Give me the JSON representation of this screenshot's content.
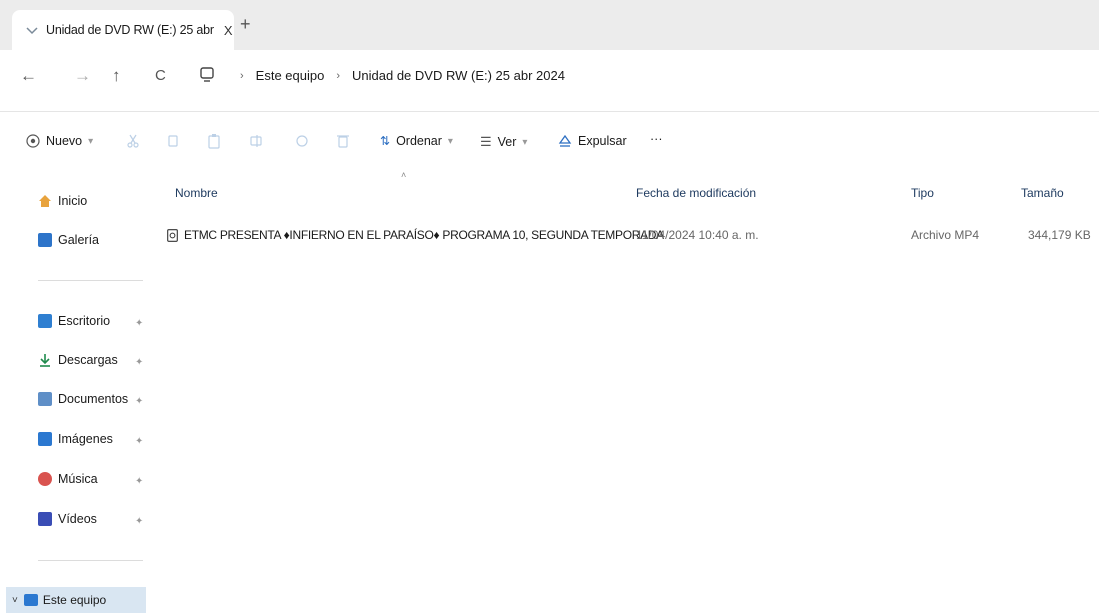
{
  "tab": {
    "title": "Unidad de DVD RW (E:) 25 abr",
    "close_label": "X",
    "new_tab_label": "+"
  },
  "nav": {
    "back_icon": "←",
    "forward_icon": "→",
    "up_icon": "↑",
    "refresh_icon": "C",
    "breadcrumbs": [
      "Este equipo",
      "Unidad de DVD RW (E:) 25 abr 2024"
    ]
  },
  "toolbar": {
    "new_label": "Nuevo",
    "sort_label": "Ordenar",
    "view_label": "Ver",
    "eject_label": "Expulsar",
    "more_label": "···"
  },
  "sidebar": {
    "items": [
      {
        "label": "Inicio",
        "icon": "home-icon",
        "color": "#e8a33d"
      },
      {
        "label": "Galería",
        "icon": "gallery-icon",
        "color": "#2d74c9"
      },
      {
        "label": "Escritorio",
        "icon": "desktop-icon",
        "color": "#2f7fd1"
      },
      {
        "label": "Descargas",
        "icon": "download-icon",
        "color": "#1f8a4c"
      },
      {
        "label": "Documentos",
        "icon": "documents-icon",
        "color": "#5f8fc7"
      },
      {
        "label": "Imágenes",
        "icon": "pictures-icon",
        "color": "#2b78d0"
      },
      {
        "label": "Música",
        "icon": "music-icon",
        "color": "#d9534f"
      },
      {
        "label": "Vídeos",
        "icon": "videos-icon",
        "color": "#3a4db5"
      }
    ],
    "this_pc_label": "Este equipo"
  },
  "columns": {
    "name": "Nombre",
    "date": "Fecha de modificación",
    "type": "Tipo",
    "size": "Tamaño"
  },
  "files": [
    {
      "name": "ETMC PRESENTA ♦INFIERNO EN EL PARAÍSO♦ PROGRAMA 10, SEGUNDA TEMPORADA",
      "date": "11/04/2024 10:40 a. m.",
      "type": "Archivo MP4",
      "size": "344,179 KB"
    }
  ],
  "colors": {
    "accent": "#0067c0",
    "selection": "#d9e6f2",
    "column_header": "#1f3b60"
  }
}
